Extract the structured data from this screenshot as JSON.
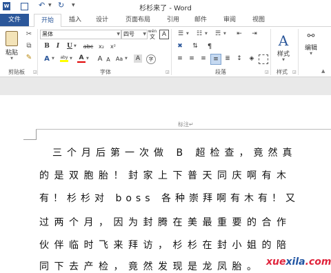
{
  "window": {
    "title": "杉杉来了 - Word"
  },
  "quick_access": {
    "word_icon": "word-icon",
    "save_icon": "save-icon",
    "undo_icon": "undo-icon",
    "redo_icon": "redo-icon"
  },
  "tabs": [
    {
      "label": "文件"
    },
    {
      "label": "开始"
    },
    {
      "label": "插入"
    },
    {
      "label": "设计"
    },
    {
      "label": "页面布局"
    },
    {
      "label": "引用"
    },
    {
      "label": "邮件"
    },
    {
      "label": "审阅"
    },
    {
      "label": "视图"
    }
  ],
  "ribbon": {
    "clipboard": {
      "paste_label": "粘贴",
      "group_label": "剪贴板"
    },
    "font": {
      "font_name": "黑体",
      "font_size": "四号",
      "wen_char": "wén",
      "wen_main": "文",
      "group_label": "字体",
      "bold": "B",
      "italic": "I",
      "underline": "U",
      "strike": "abc",
      "sub": "x₂",
      "sup": "x²",
      "clear": "A",
      "color_a": "A",
      "grow": "A",
      "shrink": "A",
      "aa": "Aa",
      "highlight": "aby"
    },
    "paragraph": {
      "group_label": "段落"
    },
    "styles": {
      "label": "样式",
      "group_label": "样式"
    },
    "editing": {
      "label": "编辑"
    }
  },
  "colors": {
    "file_tab": "#2b579a",
    "accent": "#2b579a",
    "font_color_red": "#e00000",
    "highlight_yellow": "#ffff00",
    "watermark_red": "#e0243c",
    "watermark_blue": "#2155a3"
  },
  "document": {
    "header_label": "标注",
    "lines": [
      "三个月后第一次做 B 超检查，竟然真",
      "的是双胞胎！封家上下普天同庆啊有木",
      "有！杉杉对 boss 各种崇拜啊有木有！又",
      "过两个月，因为封腾在美最重要的合作",
      "伙伴临时飞来拜访，杉杉在封小姐的陪",
      "同下去产检，竟然发现是龙凤胎。"
    ]
  },
  "watermark": {
    "part1": "xue",
    "part2": "xila",
    "part3": ".com"
  }
}
